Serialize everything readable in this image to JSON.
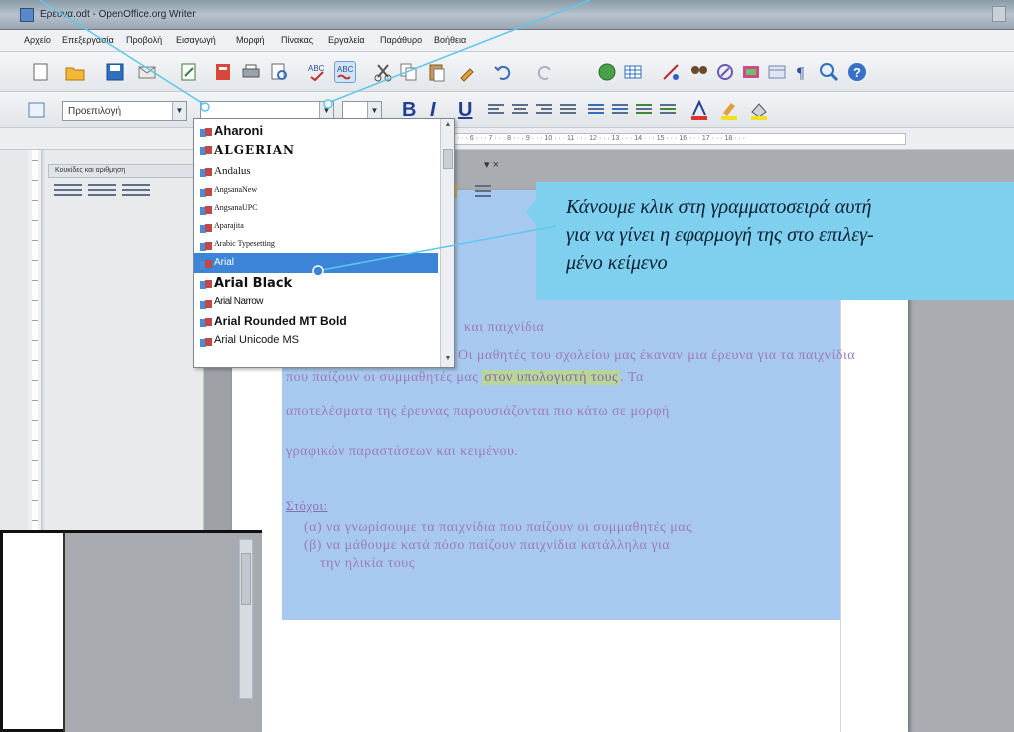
{
  "window": {
    "title": "Ερευνα.odt - OpenOffice.org Writer"
  },
  "menu": [
    "Αρχείο",
    "Επεξεργασία",
    "Προβολή",
    "Εισαγωγή",
    "Μορφή",
    "Πίνακας",
    "Εργαλεία",
    "Παράθυρο",
    "Βοήθεια"
  ],
  "format_toolbar": {
    "paragraph_style": "Προεπιλογή",
    "font_name": "",
    "font_size": "",
    "bold": "B",
    "italic": "I",
    "underline": "U"
  },
  "ruler": {
    "scale_text": "· · · 6 · · · 7 · · · 8 · · · 9 · · · 10 · · · 11 · · · 12 · · · 13 · · · 14 · · · 15 · · · 16 · · · 17 · · · 18 · · ·"
  },
  "styles_panel": {
    "title": "Κουκίδες και αριθμηση"
  },
  "font_list": {
    "items": [
      {
        "name": "Aharoni",
        "style": "aharoni"
      },
      {
        "name": "ALGERIAN",
        "style": "algerian"
      },
      {
        "name": "Andalus",
        "style": "andalus"
      },
      {
        "name": "AngsanaNew",
        "style": "small"
      },
      {
        "name": "AngsanaUPC",
        "style": "small"
      },
      {
        "name": "Aparajita",
        "style": "small"
      },
      {
        "name": "Arabic Typesetting",
        "style": "small"
      },
      {
        "name": "Arial",
        "style": "arial",
        "selected": true
      },
      {
        "name": "Arial Black",
        "style": "black"
      },
      {
        "name": "Arial Narrow",
        "style": "narrow"
      },
      {
        "name": "Arial Rounded MT Bold",
        "style": "rounded"
      },
      {
        "name": "Arial Unicode MS",
        "style": "unicode"
      }
    ]
  },
  "callout": {
    "line1": "Κάνουμε κλικ στη γραμματοσειρά αυτή",
    "line2": "για να γίνει η εφαρμογή της στο επιλεγ-",
    "line3": "μένο κείμενο"
  },
  "document": {
    "line_top": "και παιχνίδια",
    "line1": "Οι μαθητές του σχολείου μας έκαναν μια έρευνα για τα παιχνίδια",
    "line2_before": "που παίζουν οι συμμαθητές μας",
    "line2_highlight": "στον υπολογιστή τους",
    "line2_after": ". Τα",
    "line3": "αποτελέσματα της έρευνας παρουσιάζονται πιο κάτω σε μορφή",
    "line4": "γραφικών παραστάσεων και κειμένου.",
    "heading": "Στόχοι:",
    "bullet_a": "(α) να γνωρίσουμε τα παιχνίδια που παίζουν οι συμμαθητές μας",
    "bullet_b": "(β) να μάθουμε κατά πόσο παίζουν παιχνίδια κατάλληλα για",
    "bullet_b_cont": "την ηλικία τους"
  },
  "colors": {
    "selection": "#a8c9ef",
    "text": "#9c7ab5",
    "highlight": "#b8d59a",
    "callout": "#7fd0ee",
    "list_selected": "#3b84d7"
  }
}
